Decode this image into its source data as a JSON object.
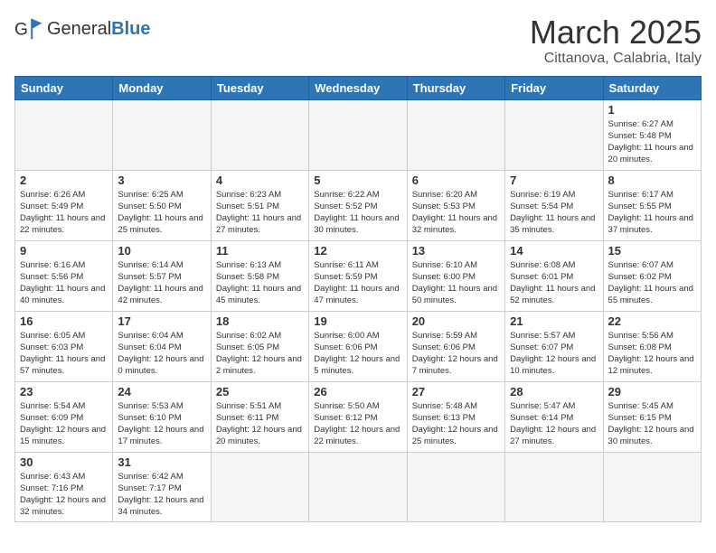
{
  "header": {
    "logo_general": "General",
    "logo_blue": "Blue",
    "title": "March 2025",
    "location": "Cittanova, Calabria, Italy"
  },
  "weekdays": [
    "Sunday",
    "Monday",
    "Tuesday",
    "Wednesday",
    "Thursday",
    "Friday",
    "Saturday"
  ],
  "weeks": [
    [
      {
        "day": null,
        "info": null
      },
      {
        "day": null,
        "info": null
      },
      {
        "day": null,
        "info": null
      },
      {
        "day": null,
        "info": null
      },
      {
        "day": null,
        "info": null
      },
      {
        "day": null,
        "info": null
      },
      {
        "day": "1",
        "info": "Sunrise: 6:27 AM\nSunset: 5:48 PM\nDaylight: 11 hours and 20 minutes."
      }
    ],
    [
      {
        "day": "2",
        "info": "Sunrise: 6:26 AM\nSunset: 5:49 PM\nDaylight: 11 hours and 22 minutes."
      },
      {
        "day": "3",
        "info": "Sunrise: 6:25 AM\nSunset: 5:50 PM\nDaylight: 11 hours and 25 minutes."
      },
      {
        "day": "4",
        "info": "Sunrise: 6:23 AM\nSunset: 5:51 PM\nDaylight: 11 hours and 27 minutes."
      },
      {
        "day": "5",
        "info": "Sunrise: 6:22 AM\nSunset: 5:52 PM\nDaylight: 11 hours and 30 minutes."
      },
      {
        "day": "6",
        "info": "Sunrise: 6:20 AM\nSunset: 5:53 PM\nDaylight: 11 hours and 32 minutes."
      },
      {
        "day": "7",
        "info": "Sunrise: 6:19 AM\nSunset: 5:54 PM\nDaylight: 11 hours and 35 minutes."
      },
      {
        "day": "8",
        "info": "Sunrise: 6:17 AM\nSunset: 5:55 PM\nDaylight: 11 hours and 37 minutes."
      }
    ],
    [
      {
        "day": "9",
        "info": "Sunrise: 6:16 AM\nSunset: 5:56 PM\nDaylight: 11 hours and 40 minutes."
      },
      {
        "day": "10",
        "info": "Sunrise: 6:14 AM\nSunset: 5:57 PM\nDaylight: 11 hours and 42 minutes."
      },
      {
        "day": "11",
        "info": "Sunrise: 6:13 AM\nSunset: 5:58 PM\nDaylight: 11 hours and 45 minutes."
      },
      {
        "day": "12",
        "info": "Sunrise: 6:11 AM\nSunset: 5:59 PM\nDaylight: 11 hours and 47 minutes."
      },
      {
        "day": "13",
        "info": "Sunrise: 6:10 AM\nSunset: 6:00 PM\nDaylight: 11 hours and 50 minutes."
      },
      {
        "day": "14",
        "info": "Sunrise: 6:08 AM\nSunset: 6:01 PM\nDaylight: 11 hours and 52 minutes."
      },
      {
        "day": "15",
        "info": "Sunrise: 6:07 AM\nSunset: 6:02 PM\nDaylight: 11 hours and 55 minutes."
      }
    ],
    [
      {
        "day": "16",
        "info": "Sunrise: 6:05 AM\nSunset: 6:03 PM\nDaylight: 11 hours and 57 minutes."
      },
      {
        "day": "17",
        "info": "Sunrise: 6:04 AM\nSunset: 6:04 PM\nDaylight: 12 hours and 0 minutes."
      },
      {
        "day": "18",
        "info": "Sunrise: 6:02 AM\nSunset: 6:05 PM\nDaylight: 12 hours and 2 minutes."
      },
      {
        "day": "19",
        "info": "Sunrise: 6:00 AM\nSunset: 6:06 PM\nDaylight: 12 hours and 5 minutes."
      },
      {
        "day": "20",
        "info": "Sunrise: 5:59 AM\nSunset: 6:06 PM\nDaylight: 12 hours and 7 minutes."
      },
      {
        "day": "21",
        "info": "Sunrise: 5:57 AM\nSunset: 6:07 PM\nDaylight: 12 hours and 10 minutes."
      },
      {
        "day": "22",
        "info": "Sunrise: 5:56 AM\nSunset: 6:08 PM\nDaylight: 12 hours and 12 minutes."
      }
    ],
    [
      {
        "day": "23",
        "info": "Sunrise: 5:54 AM\nSunset: 6:09 PM\nDaylight: 12 hours and 15 minutes."
      },
      {
        "day": "24",
        "info": "Sunrise: 5:53 AM\nSunset: 6:10 PM\nDaylight: 12 hours and 17 minutes."
      },
      {
        "day": "25",
        "info": "Sunrise: 5:51 AM\nSunset: 6:11 PM\nDaylight: 12 hours and 20 minutes."
      },
      {
        "day": "26",
        "info": "Sunrise: 5:50 AM\nSunset: 6:12 PM\nDaylight: 12 hours and 22 minutes."
      },
      {
        "day": "27",
        "info": "Sunrise: 5:48 AM\nSunset: 6:13 PM\nDaylight: 12 hours and 25 minutes."
      },
      {
        "day": "28",
        "info": "Sunrise: 5:47 AM\nSunset: 6:14 PM\nDaylight: 12 hours and 27 minutes."
      },
      {
        "day": "29",
        "info": "Sunrise: 5:45 AM\nSunset: 6:15 PM\nDaylight: 12 hours and 30 minutes."
      }
    ],
    [
      {
        "day": "30",
        "info": "Sunrise: 6:43 AM\nSunset: 7:16 PM\nDaylight: 12 hours and 32 minutes."
      },
      {
        "day": "31",
        "info": "Sunrise: 6:42 AM\nSunset: 7:17 PM\nDaylight: 12 hours and 34 minutes."
      },
      {
        "day": null,
        "info": null
      },
      {
        "day": null,
        "info": null
      },
      {
        "day": null,
        "info": null
      },
      {
        "day": null,
        "info": null
      },
      {
        "day": null,
        "info": null
      }
    ]
  ]
}
